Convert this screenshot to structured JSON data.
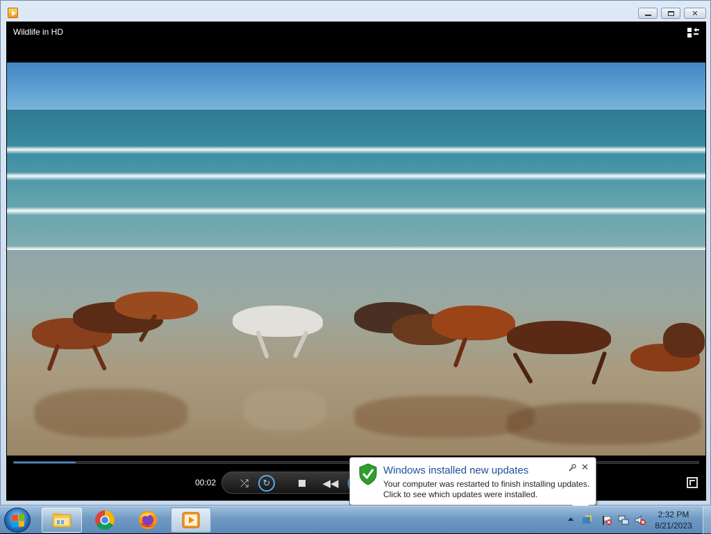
{
  "window": {
    "title_icon": "media-player-icon",
    "buttons": {
      "minimize": "minimize",
      "maximize": "maximize",
      "close": "close"
    }
  },
  "player": {
    "video_title": "Wildlife in HD",
    "current_time": "00:02",
    "progress_fraction": 0.09,
    "controls": [
      "shuffle-icon",
      "repeat-icon",
      "stop-icon",
      "previous-icon",
      "play-icon"
    ],
    "switch_icon": "switch-to-library-icon",
    "fullscreen_icon": "fullscreen-icon"
  },
  "notification": {
    "title": "Windows installed new updates",
    "line1": "Your computer was restarted to finish installing updates.",
    "line2": "Click to see which updates were installed.",
    "close_glyph": "✕",
    "options_glyph": "🔧"
  },
  "taskbar": {
    "apps": [
      "start-button",
      "file-explorer-icon",
      "chrome-icon",
      "firefox-icon",
      "media-player-icon"
    ],
    "clock": {
      "time": "2:32 PM",
      "date": "8/21/2023"
    }
  }
}
